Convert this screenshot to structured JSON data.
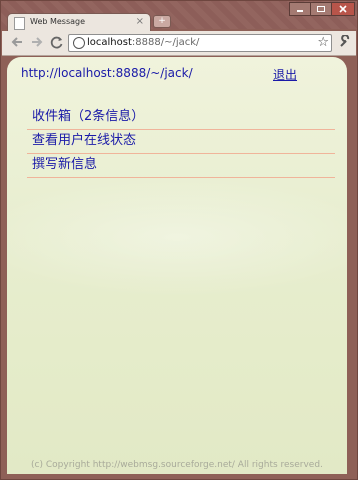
{
  "browser": {
    "tab_title": "Web Message",
    "tab_close": "×",
    "new_tab": "+",
    "url_host": "localhost",
    "url_path": ":8888/~/jack/",
    "icons": {
      "back": "back-arrow-icon",
      "forward": "forward-arrow-icon",
      "reload": "reload-icon",
      "star": "star-icon",
      "wrench": "wrench-icon"
    }
  },
  "page": {
    "address": "http://localhost:8888/~/jack/",
    "logout": "退出",
    "menu": [
      {
        "label": "收件箱（2条信息）"
      },
      {
        "label": "查看用户在线状态"
      },
      {
        "label": "撰写新信息"
      }
    ],
    "footer": "(c) Copyright http://webmsg.sourceforge.net/ All rights reserved."
  }
}
